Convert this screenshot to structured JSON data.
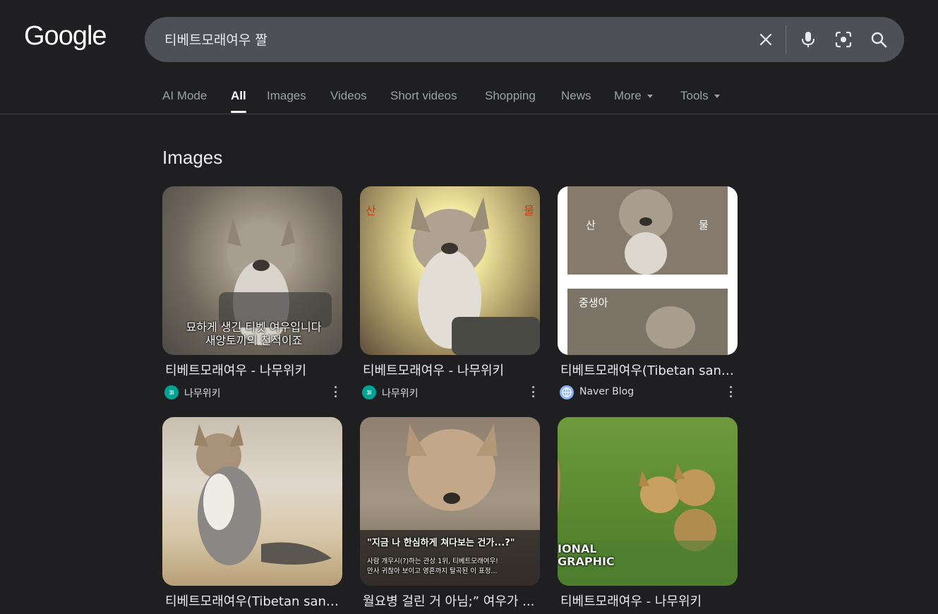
{
  "logo": "Google",
  "search": {
    "query": "티베트모래여우 짤"
  },
  "tabs": [
    {
      "label": "AI Mode"
    },
    {
      "label": "All"
    },
    {
      "label": "Images"
    },
    {
      "label": "Videos"
    },
    {
      "label": "Short videos"
    },
    {
      "label": "Shopping"
    },
    {
      "label": "News"
    },
    {
      "label": "More"
    },
    {
      "label": "Tools"
    }
  ],
  "section_title": "Images",
  "results": [
    {
      "title": "티베트모래여우 - 나무위키",
      "source": "나무위키",
      "source_icon": "namuwiki-icon",
      "overlay_line1": "묘하게 생긴 티벳 여우입니다",
      "overlay_line2": "새앙토끼의 천적이죠"
    },
    {
      "title": "티베트모래여우 - 나무위키",
      "source": "나무위키",
      "source_icon": "namuwiki-icon"
    },
    {
      "title": "티베트모래여우(Tibetan sand ...",
      "source": "Naver Blog",
      "source_icon": "globe-icon"
    },
    {
      "title": "티베트모래여우(Tibetan sand ...",
      "source": "",
      "source_icon": "globe-icon"
    },
    {
      "title": "월요병 걸린 거 아님;” 여우가 ...",
      "source": "",
      "source_icon": "site-icon",
      "overlay_line1": "\"지금 나 한심하게 쳐다보는 건가...?\"",
      "overlay_line2": "사람 개무시(?)하는 관상 1위, 티베트모래여우!",
      "overlay_line3": "만사 귀찮아 보이고 영혼까지 탈곡된 이 표정..."
    },
    {
      "title": "티베트모래여우 - 나무위키",
      "source": "",
      "source_icon": "namuwiki-icon",
      "overlay_line1": "IONAL",
      "overlay_line2": "GRAPHIC"
    }
  ],
  "colors": {
    "background": "#1f1f22",
    "searchbar": "#4d5156",
    "namuwiki": "#00a495"
  }
}
